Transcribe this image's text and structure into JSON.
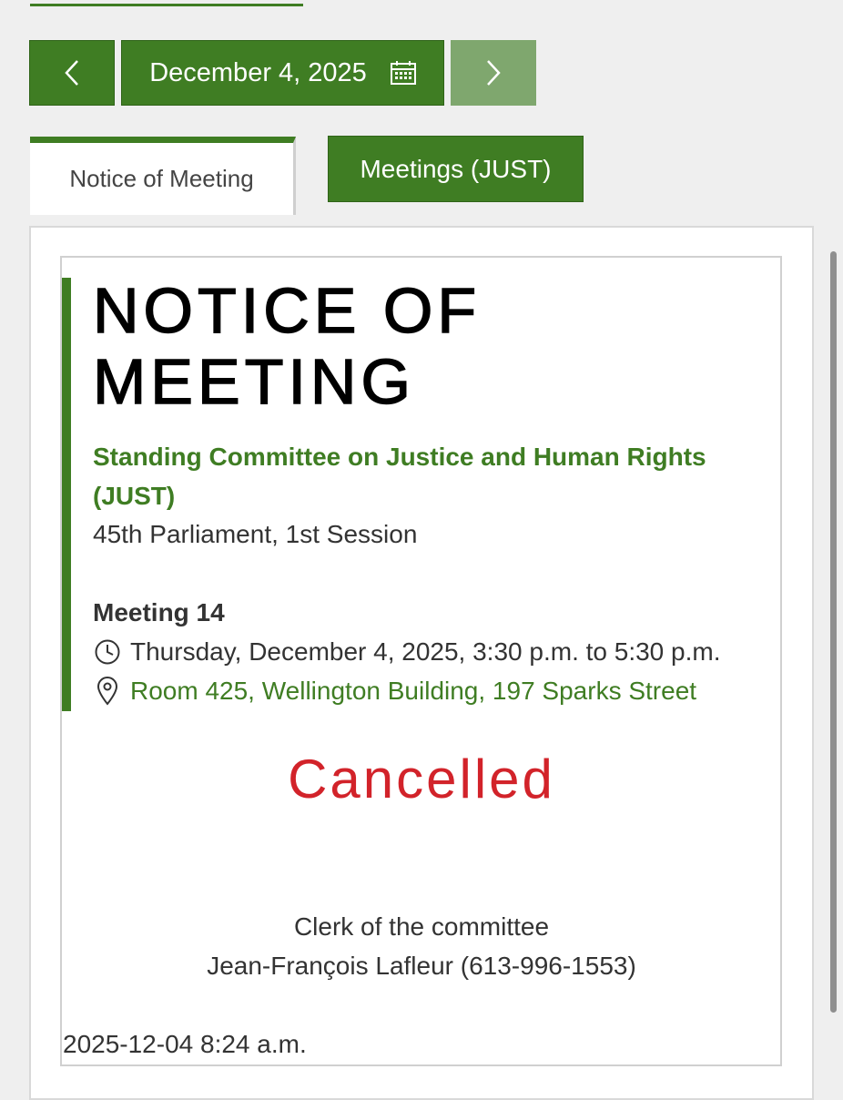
{
  "date_nav": {
    "prev_icon": "chevron-left-icon",
    "date_label": "December 4, 2025",
    "calendar_icon": "calendar-icon",
    "next_icon": "chevron-right-icon"
  },
  "tabs": [
    {
      "label": "Notice of Meeting",
      "active": true
    },
    {
      "label": "Meetings (JUST)",
      "active": false
    }
  ],
  "notice": {
    "title_line1": "NOTICE OF",
    "title_line2": "MEETING",
    "committee": "Standing Committee on Justice and Human Rights (JUST)",
    "session": "45th Parliament, 1st Session",
    "meeting_number": "Meeting 14",
    "time_icon": "clock-icon",
    "datetime": "Thursday, December 4, 2025, 3:30 p.m. to 5:30 p.m.",
    "location_icon": "map-pin-icon",
    "location": "Room 425, Wellington Building, 197 Sparks Street",
    "status": "Cancelled",
    "clerk_label": "Clerk of the committee",
    "clerk_name": "Jean-François Lafleur (613-996-1553)",
    "published": "2025-12-04 8:24 a.m."
  },
  "colors": {
    "brand_green": "#3f7d23",
    "disabled_green": "#7fa76e",
    "cancelled_red": "#d2232a"
  }
}
